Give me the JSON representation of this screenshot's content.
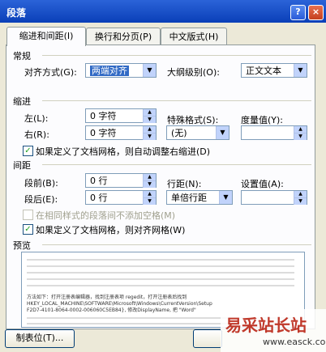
{
  "title": "段落",
  "title_buttons": {
    "help": "?",
    "close": "×"
  },
  "tabs": [
    "缩进和间距(I)",
    "换行和分页(P)",
    "中文版式(H)"
  ],
  "general": {
    "heading": "常规",
    "alignment_label": "对齐方式(G):",
    "alignment_value": "两端对齐",
    "outline_label": "大纲级别(O):",
    "outline_value": "正文文本"
  },
  "indent": {
    "heading": "缩进",
    "left_label": "左(L):",
    "left_value": "0 字符",
    "right_label": "右(R):",
    "right_value": "0 字符",
    "special_label": "特殊格式(S):",
    "special_value": "(无)",
    "measure_label": "度量值(Y):",
    "measure_value": "",
    "auto_adjust_label": "如果定义了文档网格，则自动调整右缩进(D)"
  },
  "spacing": {
    "heading": "间距",
    "before_label": "段前(B):",
    "before_value": "0 行",
    "after_label": "段后(E):",
    "after_value": "0 行",
    "line_label": "行距(N):",
    "line_value": "单倍行距",
    "at_label": "设置值(A):",
    "at_value": "",
    "no_space_same_style_label": "在相同样式的段落间不添加空格(M)",
    "snap_grid_label": "如果定义了文档网格，则对齐网格(W)"
  },
  "preview": {
    "heading": "预览",
    "sample_lines": [
      "方法如下：打开注册表编辑器，找到注册表项 regedit，打开注册表后找到",
      "HKEY_LOCAL_MACHINE\\SOFTWARE\\Microsoft\\Windows\\CurrentVersion\\Setup",
      "F2D7-4101-8064-0002-006060C5EB84}, 修改DisplayName, 把 \"Word\""
    ]
  },
  "buttons": {
    "tabs": "制表位(T)..."
  },
  "watermark": {
    "text": "易采站长站",
    "url": "www.easck.com"
  },
  "colors": {
    "title_bar": "#0a3fb8",
    "dialog_bg": "#ece9d8",
    "watermark": "#c0392b"
  }
}
